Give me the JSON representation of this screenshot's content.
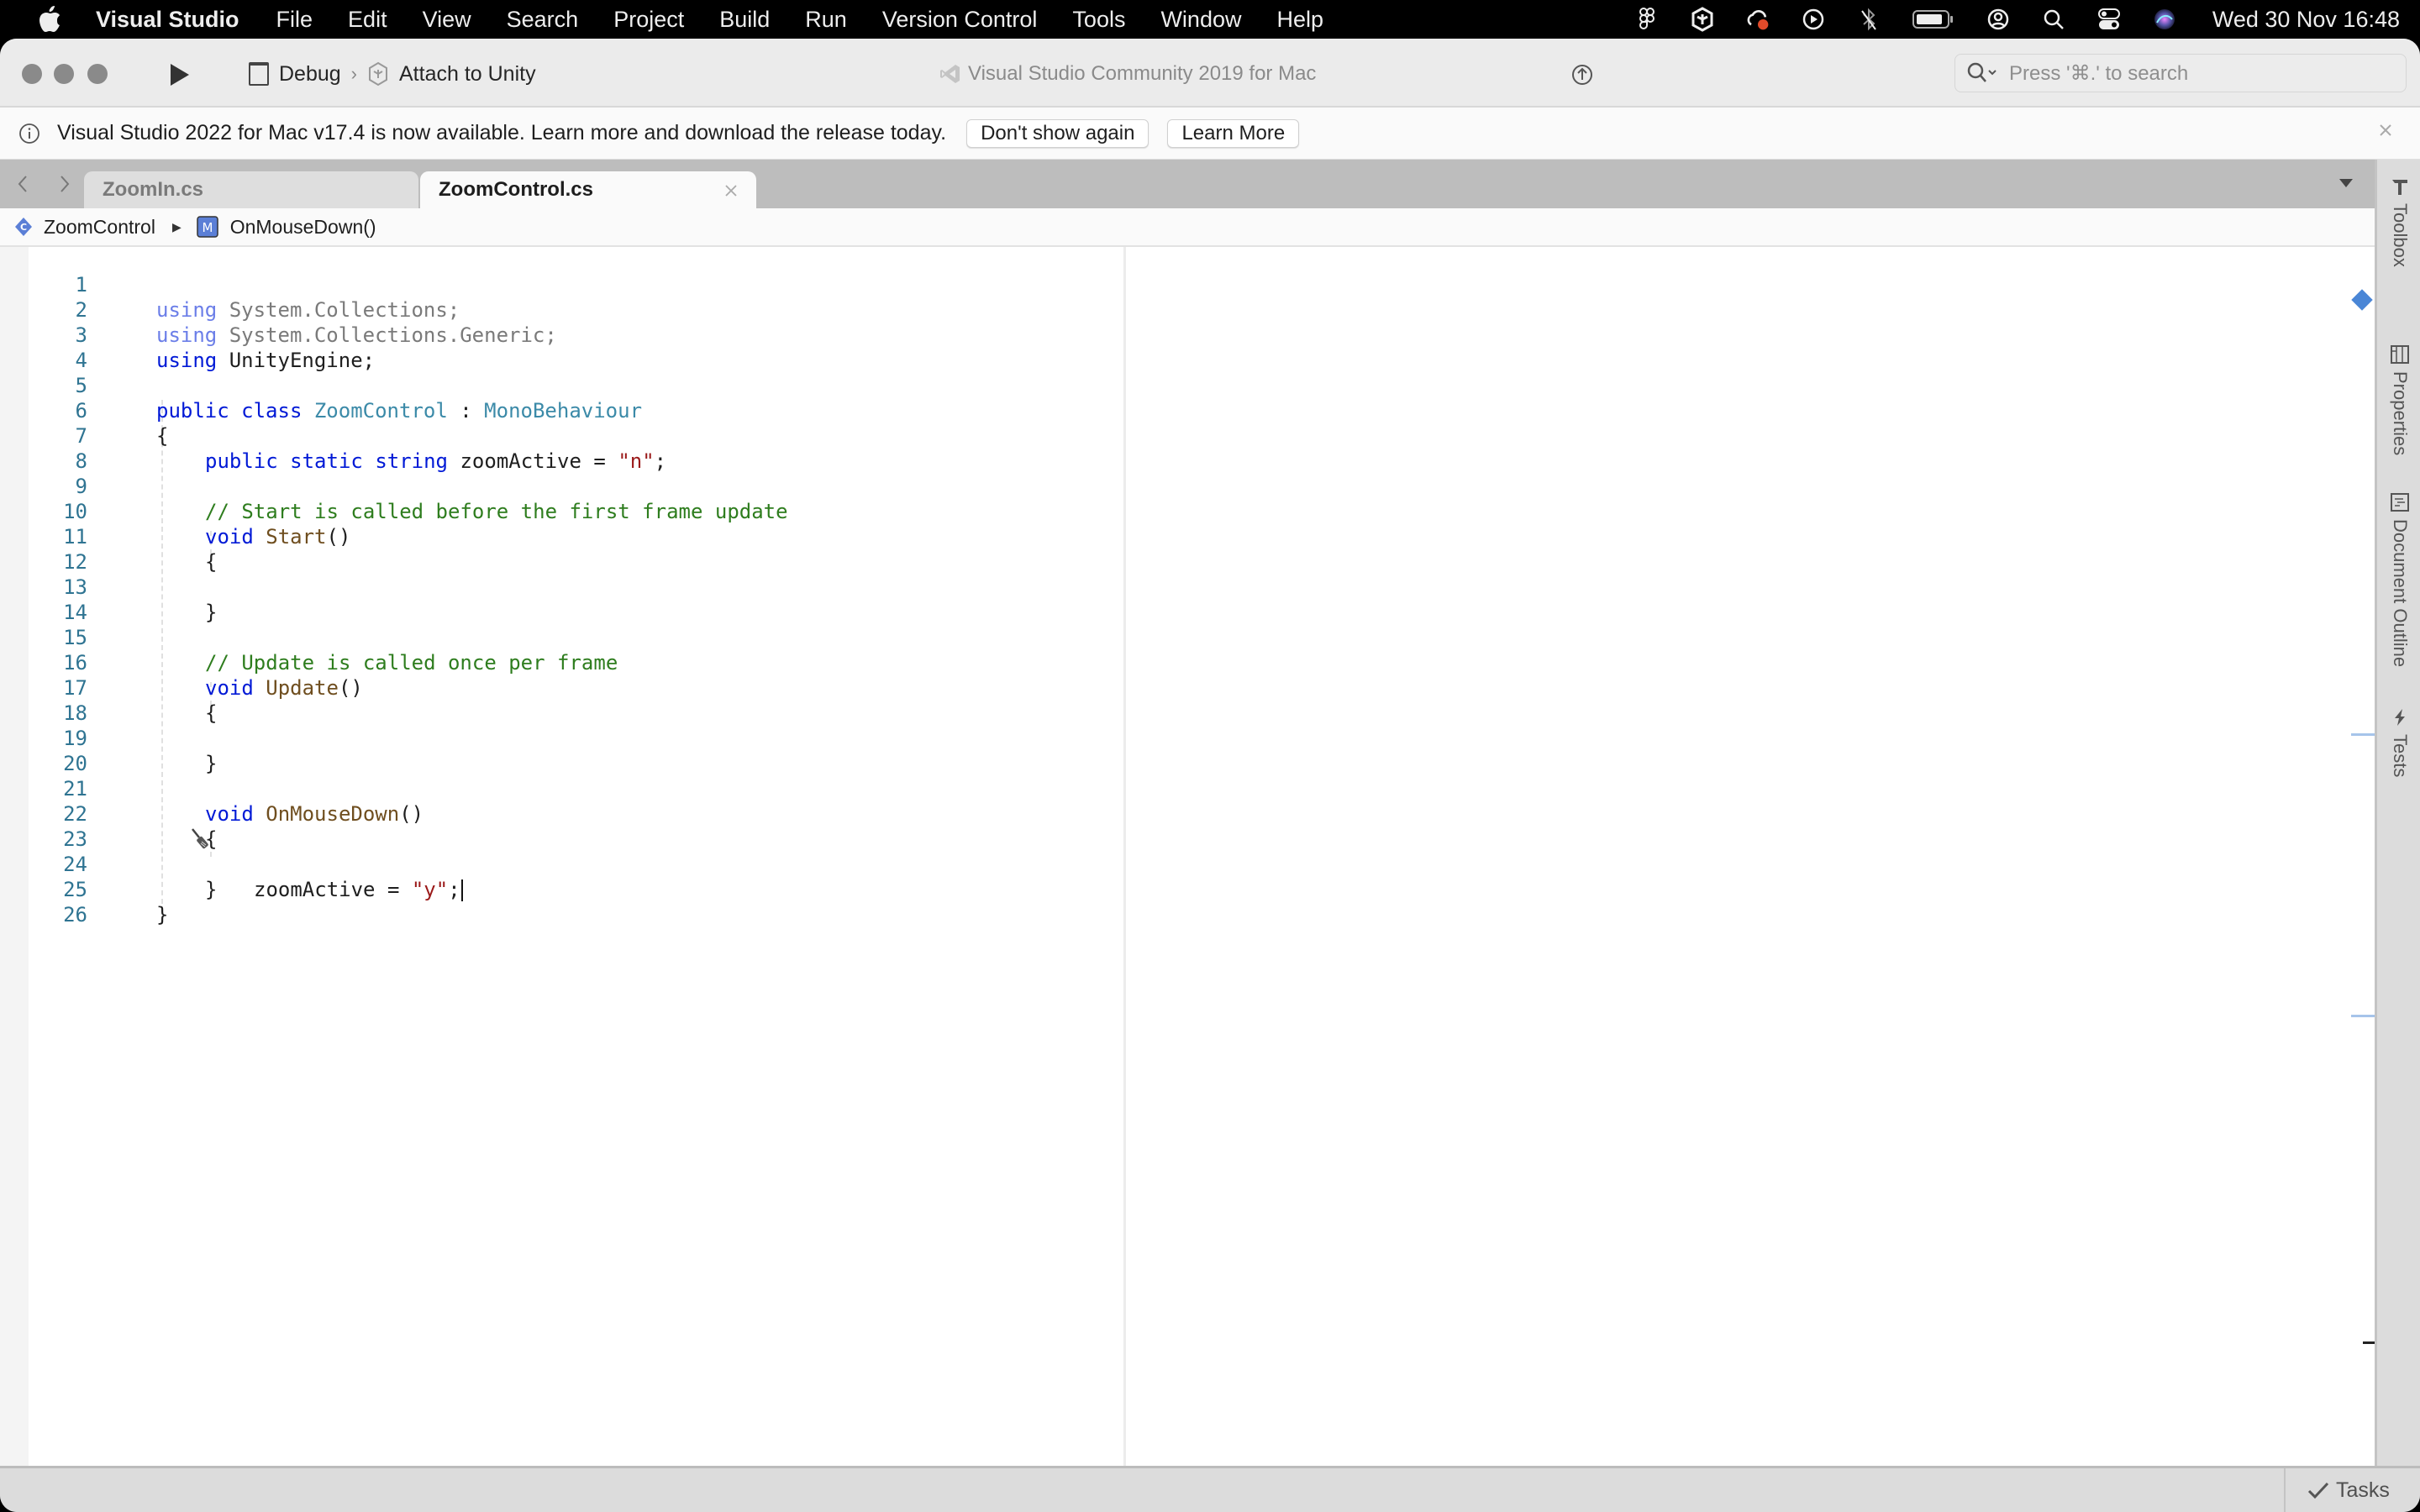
{
  "menubar": {
    "app_name": "Visual Studio",
    "items": [
      "File",
      "Edit",
      "View",
      "Search",
      "Project",
      "Build",
      "Run",
      "Version Control",
      "Tools",
      "Window",
      "Help"
    ],
    "status_icons": [
      "figma-icon",
      "unity-icon",
      "creative-cloud-icon",
      "play-circle-icon",
      "bluetooth-off-icon",
      "battery-icon",
      "user-icon",
      "spotlight-search-icon",
      "control-center-icon",
      "siri-icon"
    ],
    "clock": "Wed 30 Nov  16:48"
  },
  "toolbar": {
    "configuration": "Debug",
    "target": "Attach to Unity",
    "window_title": "Visual Studio Community 2019 for Mac",
    "search_placeholder": "Press '⌘.' to search"
  },
  "infobar": {
    "message": "Visual Studio 2022 for Mac v17.4 is now available. Learn more and download the release today.",
    "dont_show_label": "Don't show again",
    "learn_more_label": "Learn More"
  },
  "tabs": [
    {
      "label": "ZoomIn.cs",
      "active": false
    },
    {
      "label": "ZoomControl.cs",
      "active": true
    }
  ],
  "breadcrumb": {
    "class_name": "ZoomControl",
    "method_name": "OnMouseDown()"
  },
  "editor": {
    "lines": [
      {
        "n": "1"
      },
      {
        "n": "2"
      },
      {
        "n": "3"
      },
      {
        "n": "4"
      },
      {
        "n": "5"
      },
      {
        "n": "6"
      },
      {
        "n": "7"
      },
      {
        "n": "8"
      },
      {
        "n": "9"
      },
      {
        "n": "10"
      },
      {
        "n": "11"
      },
      {
        "n": "12"
      },
      {
        "n": "13"
      },
      {
        "n": "14"
      },
      {
        "n": "15"
      },
      {
        "n": "16"
      },
      {
        "n": "17"
      },
      {
        "n": "18"
      },
      {
        "n": "19"
      },
      {
        "n": "20"
      },
      {
        "n": "21"
      },
      {
        "n": "22"
      },
      {
        "n": "23"
      },
      {
        "n": "24"
      },
      {
        "n": "25"
      },
      {
        "n": "26"
      }
    ],
    "tokens": {
      "using": "using",
      "ns1": " System.Collections;",
      "ns2": " System.Collections.Generic;",
      "ns3": " UnityEngine;",
      "public": "public",
      "class": "class",
      "class_name": "ZoomControl",
      "colon": " : ",
      "base": "MonoBehaviour",
      "open_brace": "{",
      "close_brace": "}",
      "static": "static",
      "string": "string",
      "field_assign": " zoomActive = ",
      "str_n": "\"n\"",
      "semicolon": ";",
      "comment_start": "// Start is called before the first frame update",
      "void": "void",
      "start_fn": "Start",
      "parens": "()",
      "comment_update": "// Update is called once per frame",
      "update_fn": "Update",
      "mousedown_fn": "OnMouseDown",
      "assign": "zoomActive = ",
      "str_y": "\"y\""
    }
  },
  "sidebar": {
    "tabs": [
      "Toolbox",
      "Properties",
      "Document Outline",
      "Tests"
    ]
  },
  "statusbar": {
    "tasks_label": "Tasks"
  }
}
